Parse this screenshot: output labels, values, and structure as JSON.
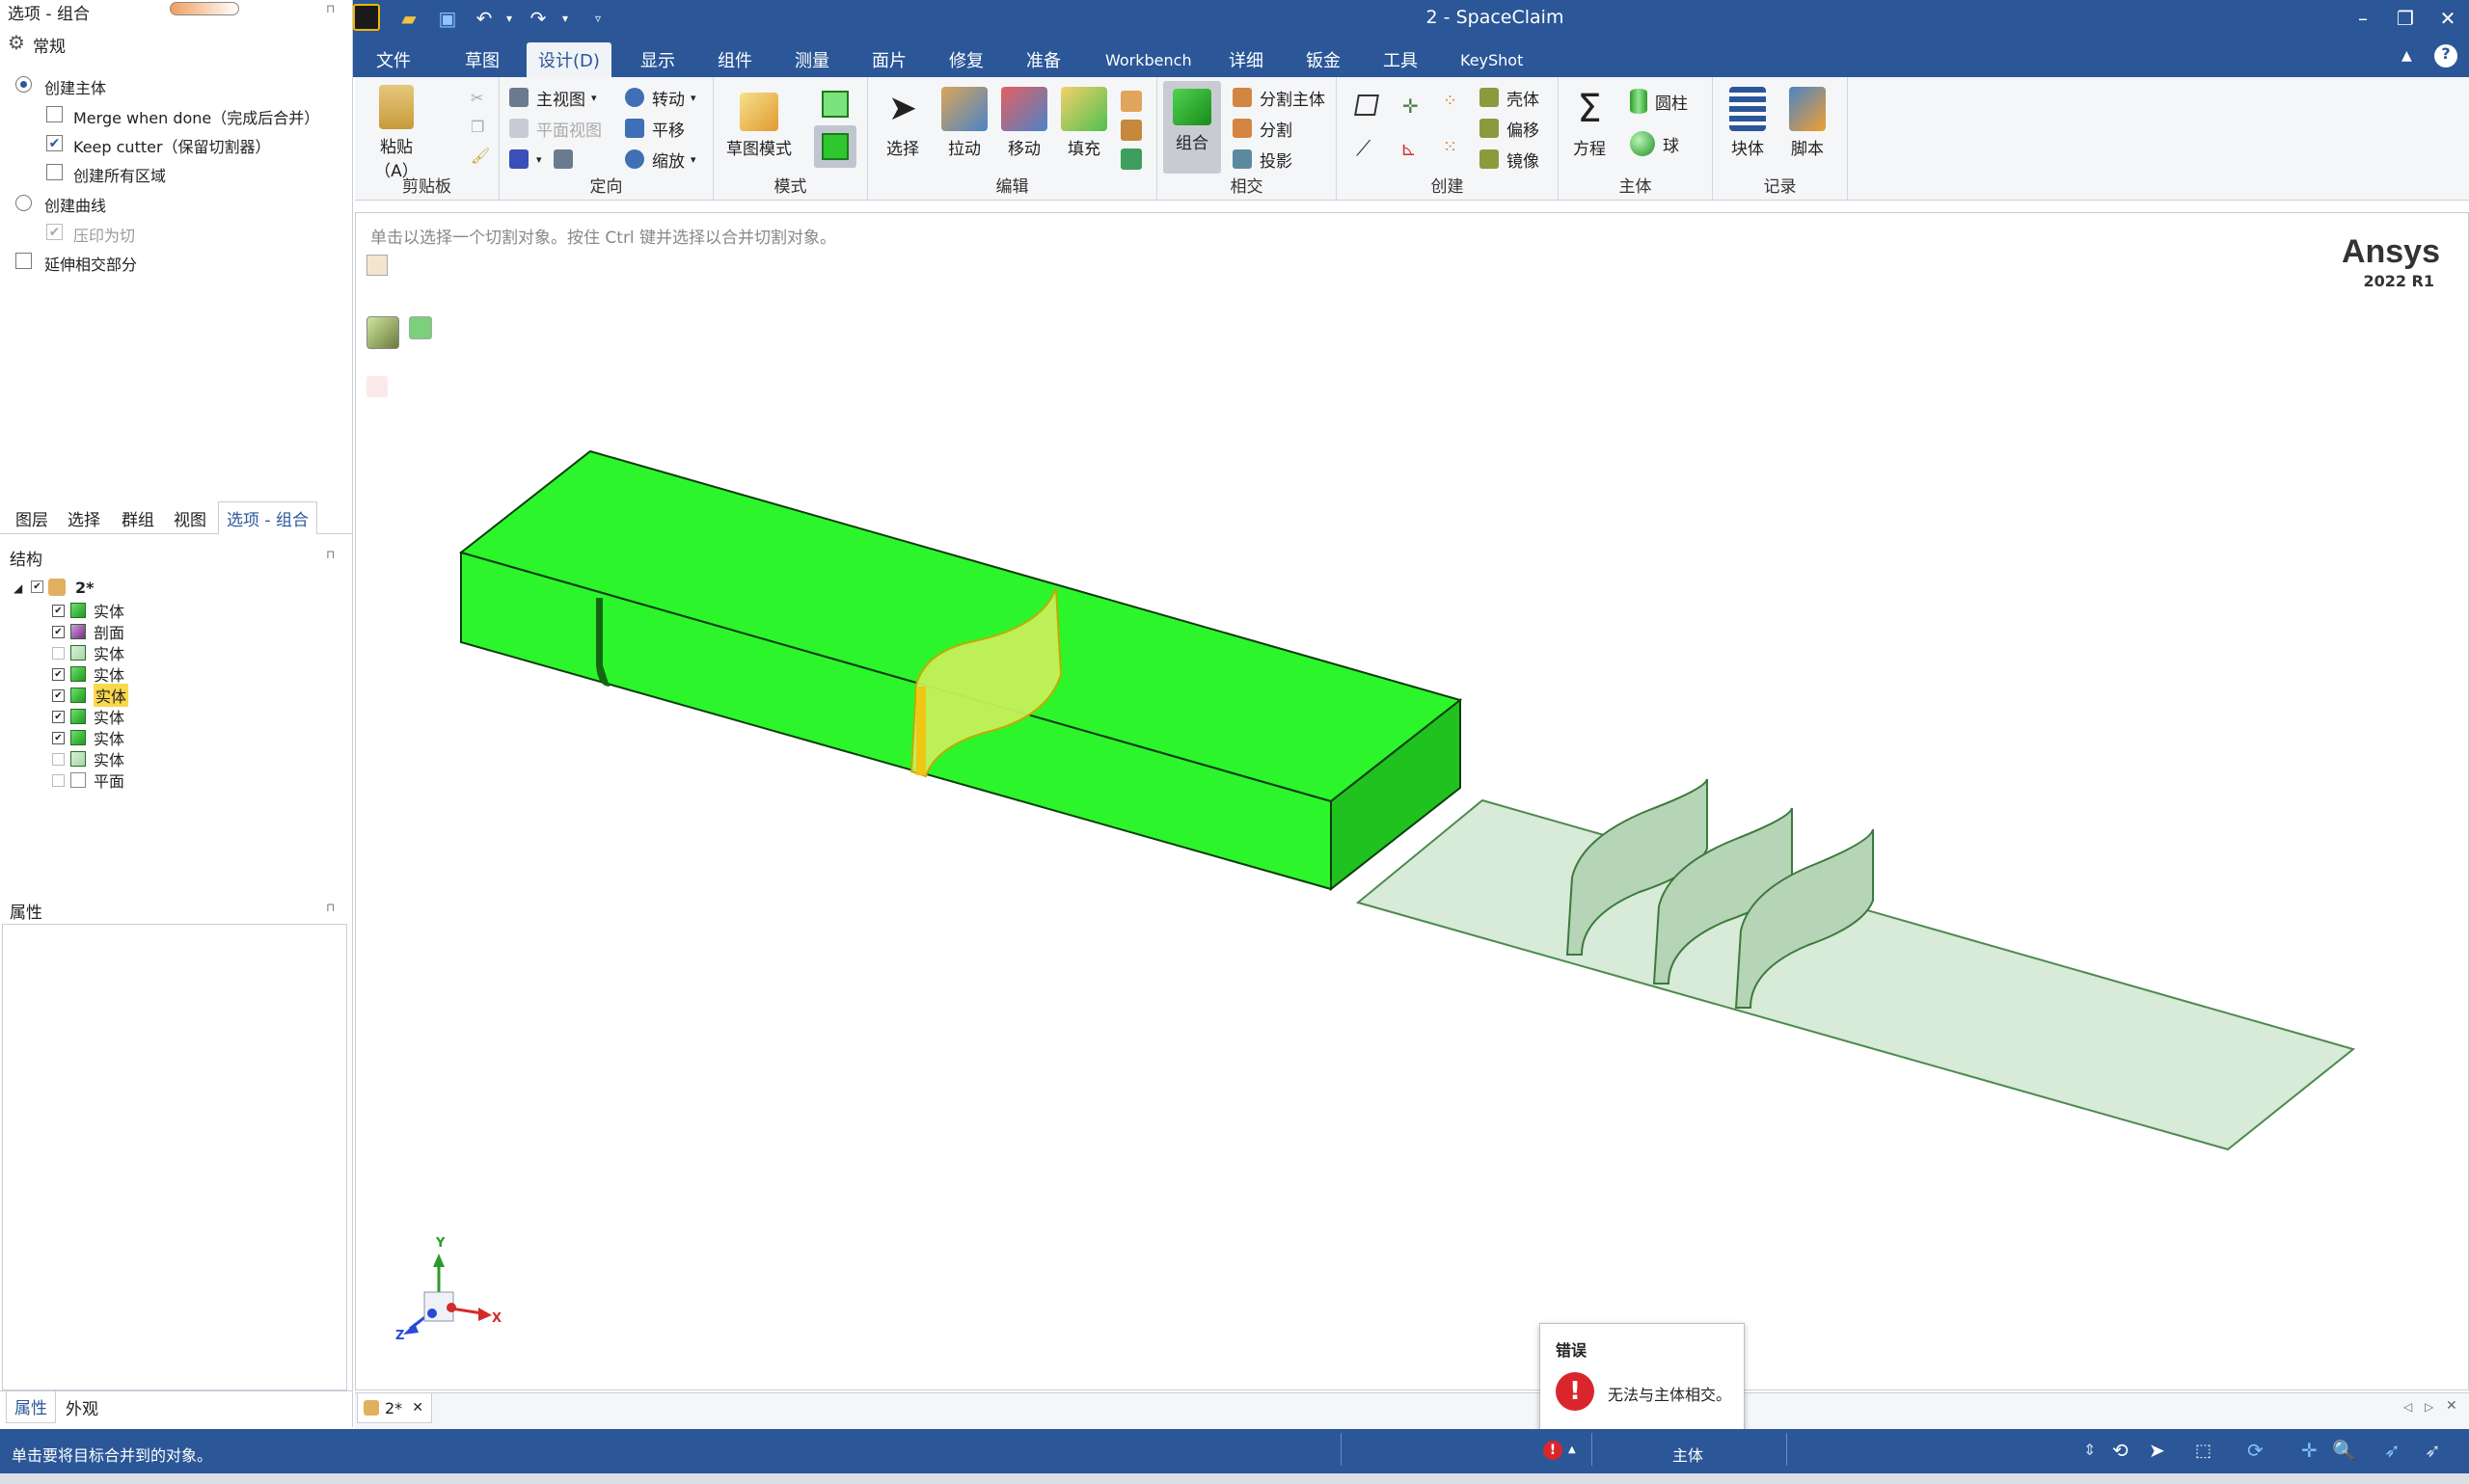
{
  "window": {
    "title": "2 - SpaceClaim",
    "minimize": "–",
    "restore": "❐",
    "close": "✕"
  },
  "quick_access": [
    "open-folder-icon",
    "save-icon",
    "undo-icon",
    "redo-icon",
    "customize-icon"
  ],
  "menu_tabs": [
    "文件",
    "草图",
    "设计(D)",
    "显示",
    "组件",
    "测量",
    "面片",
    "修复",
    "准备",
    "Workbench",
    "详细",
    "钣金",
    "工具",
    "KeyShot"
  ],
  "active_tab": "设计(D)",
  "ribbon": {
    "clipboard": {
      "paste": "粘贴（A）",
      "label": "剪贴板"
    },
    "orient": {
      "home_view": "主视图",
      "plane_view": "平面视图",
      "spin": "转动",
      "pan": "平移",
      "zoom": "缩放",
      "label": "定向"
    },
    "mode": {
      "sketch_mode": "草图模式",
      "label": "模式"
    },
    "edit": {
      "select": "选择",
      "pull": "拉动",
      "move": "移动",
      "fill": "填充",
      "label": "编辑"
    },
    "intersect": {
      "combine": "组合",
      "split_body": "分割主体",
      "split": "分割",
      "project": "投影",
      "label": "相交"
    },
    "create": {
      "shell": "壳体",
      "offset": "偏移",
      "mirror": "镜像",
      "label": "创建"
    },
    "body": {
      "equation": "方程",
      "cylinder": "圆柱",
      "sphere": "球",
      "label": "主体"
    },
    "record": {
      "block": "块体",
      "script": "脚本",
      "label": "记录"
    }
  },
  "options_panel": {
    "title": "选项 - 组合",
    "section": "常规",
    "create_body": "创建主体",
    "merge_when_done": "Merge when done（完成后合并）",
    "keep_cutter": "Keep cutter（保留切割器）",
    "create_all_regions": "创建所有区域",
    "create_curves": "创建曲线",
    "imprint_as_cut": "压印为切",
    "extend_intersecting": "延伸相交部分"
  },
  "panel_tabs": [
    "图层",
    "选择",
    "群组",
    "视图",
    "选项 - 组合"
  ],
  "structure": {
    "title": "结构",
    "root": "2*",
    "items": [
      {
        "label": "实体",
        "checked": true,
        "kind": "body"
      },
      {
        "label": "剖面",
        "checked": true,
        "kind": "section"
      },
      {
        "label": "实体",
        "checked": false,
        "kind": "body-faded"
      },
      {
        "label": "实体",
        "checked": true,
        "kind": "body"
      },
      {
        "label": "实体",
        "checked": true,
        "kind": "body",
        "selected": true
      },
      {
        "label": "实体",
        "checked": true,
        "kind": "body"
      },
      {
        "label": "实体",
        "checked": true,
        "kind": "body"
      },
      {
        "label": "实体",
        "checked": false,
        "kind": "body-faded"
      },
      {
        "label": "平面",
        "checked": false,
        "kind": "plane"
      }
    ]
  },
  "properties": {
    "title": "属性",
    "tabs": [
      "属性",
      "外观"
    ]
  },
  "viewport": {
    "hint": "单击以选择一个切割对象。按住 Ctrl 键并选择以合并切割对象。",
    "brand": "Ansys",
    "version": "2022 R1",
    "axes": {
      "x": "X",
      "y": "Y",
      "z": "Z"
    },
    "doc_tab": "2*"
  },
  "error": {
    "title": "错误",
    "message": "无法与主体相交。"
  },
  "status": {
    "message": "单击要将目标合并到的对象。",
    "mode": "主体"
  },
  "colors": {
    "brand_blue": "#2b5798",
    "body_green": "#2cf52c",
    "ghost_green": "#d8ead8",
    "error_red": "#d9262c"
  }
}
